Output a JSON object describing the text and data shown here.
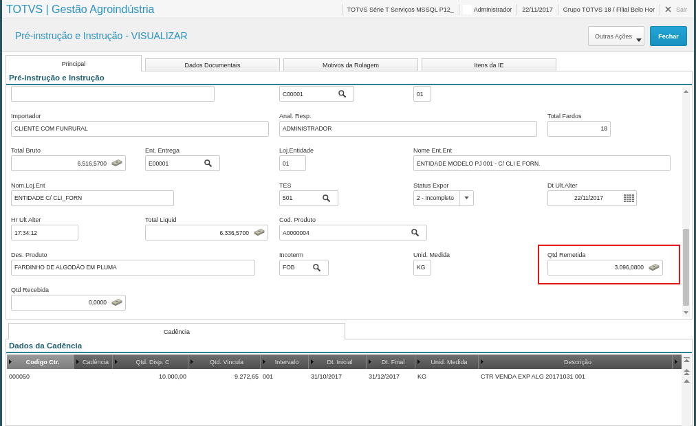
{
  "app_bar": {
    "title": "TOTVS | Gestão Agroindústria",
    "environment": "TOTVS Série T Serviços MSSQL P12_",
    "user": "Administrador",
    "date": "22/11/2017",
    "branch": "Grupo TOTVS 18 / Filial Belo Hor",
    "logout": "Sair"
  },
  "header": {
    "title": "Pré-instrução e Instrução - VISUALIZAR",
    "buttons": [
      {
        "label": "Outras Ações",
        "kind": "menu"
      },
      {
        "label": "Fechar",
        "kind": "primary"
      }
    ]
  },
  "tabs": [
    {
      "label": "Principal",
      "selected": true
    },
    {
      "label": "Dados Documentais",
      "selected": false
    },
    {
      "label": "Motivos da Rolagem",
      "selected": false
    },
    {
      "label": "Itens da IE",
      "selected": false
    }
  ],
  "form": {
    "title": "Pré-instrução e Instrução",
    "rows": [
      {
        "fields": [
          {
            "kind": "text",
            "highlighted": false
          },
          {
            "value": "C00001",
            "kind": "search",
            "highlighted": false
          },
          {
            "value": "01",
            "kind": "text",
            "highlighted": false
          }
        ]
      },
      {
        "fields": [
          {
            "label": "Importador",
            "value": "CLIENTE COM FUNRURAL",
            "kind": "text",
            "highlighted": false
          },
          {
            "label": "Anal. Resp.",
            "value": "ADMINISTRADOR",
            "kind": "text",
            "highlighted": false
          },
          {
            "label": "Total Fardos",
            "value": "18",
            "kind": "number",
            "highlighted": false
          }
        ]
      },
      {
        "fields": [
          {
            "label": "Total Bruto",
            "value": "6.516,5700",
            "kind": "money",
            "highlighted": false
          },
          {
            "label": "Ent. Entrega",
            "value": "E00001",
            "kind": "search",
            "highlighted": false
          },
          {
            "label": "Loj.Entidade",
            "value": "01",
            "kind": "text",
            "highlighted": false
          },
          {
            "label": "Nome Ent.Ent",
            "value": "ENTIDADE MODELO PJ 001 - C/ CLI E FORN.",
            "kind": "text",
            "highlighted": false
          }
        ]
      },
      {
        "fields": [
          {
            "label": "Nom.Loj.Ent",
            "value": "ENTIDADE C/ CLI_FORN",
            "kind": "text",
            "highlighted": false
          },
          {
            "label": "TES",
            "value": "501",
            "kind": "search",
            "highlighted": false
          },
          {
            "label": "Status Expor",
            "value": "2 - Incompleto",
            "kind": "select",
            "highlighted": false
          },
          {
            "label": "Dt Ult.Alter",
            "value": "22/11/2017",
            "kind": "date",
            "highlighted": false
          }
        ]
      },
      {
        "fields": [
          {
            "label": "Hr Ult Alter",
            "value": "17:34:12",
            "kind": "text",
            "highlighted": false
          },
          {
            "label": "Total Liquid",
            "value": "6.336,5700",
            "kind": "money",
            "highlighted": false
          },
          {
            "label": "Cod. Produto",
            "value": "A0000004",
            "kind": "search",
            "highlighted": false
          }
        ]
      },
      {
        "fields": [
          {
            "label": "Des. Produto",
            "value": "FARDINHO DE ALGODÃO EM PLUMA",
            "kind": "text",
            "highlighted": false
          },
          {
            "label": "Incoterm",
            "value": "FOB",
            "kind": "search",
            "highlighted": false
          },
          {
            "label": "Unid. Medida",
            "value": "KG",
            "kind": "text",
            "highlighted": false
          },
          {
            "label": "Qtd Remetida",
            "value": "3.096,0800",
            "kind": "money",
            "highlighted": true
          }
        ]
      },
      {
        "fields": [
          {
            "label": "Qtd Recebida",
            "value": "0,0000",
            "kind": "money",
            "highlighted": false
          }
        ]
      }
    ]
  },
  "detail_tabs": [
    {
      "label": "Cadência",
      "selected": true
    }
  ],
  "grid": {
    "title": "Dados da Cadência",
    "columns": [
      {
        "label": "Codigo Ctr.",
        "selected": true
      },
      {
        "label": "Cadência",
        "selected": false
      },
      {
        "label": "Qtd. Disp. C",
        "selected": false
      },
      {
        "label": "Qtd. Vincula",
        "selected": false
      },
      {
        "label": "Intervalo",
        "selected": false
      },
      {
        "label": "Dt. Inicial",
        "selected": false
      },
      {
        "label": "Dt. Final",
        "selected": false
      },
      {
        "label": "Unid. Medida",
        "selected": false
      },
      {
        "label": "Descrição",
        "selected": false
      }
    ],
    "rows": [
      [
        "000050",
        null,
        "10.000,00",
        "9.272,65",
        "001",
        "31/10/2017",
        "31/12/2017",
        "KG",
        "CTR VENDA EXP ALG 20171031 001"
      ]
    ]
  }
}
